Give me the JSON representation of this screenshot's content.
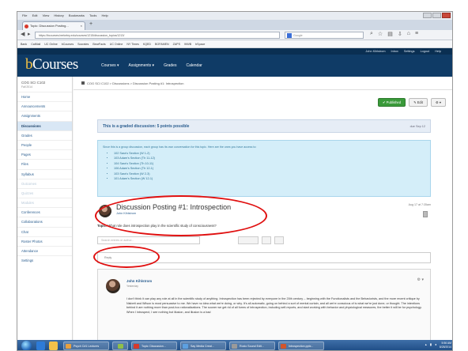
{
  "browser": {
    "menu": [
      "File",
      "Edit",
      "View",
      "History",
      "Bookmarks",
      "Tools",
      "Help"
    ],
    "tab_title": "Topic: Discussion Posting...",
    "tab_close": "×",
    "new_tab": "+",
    "url": "https://bcourses.berkeley.edu/courses/1215/discussion_topics/1213/",
    "search_placeholder": "Google",
    "bookmarks": [
      "Bank",
      "CalMail",
      "UC Online",
      "bCourses",
      "Socrates",
      "BearFacts",
      "UC Online",
      "NY Times",
      "KQED",
      "BOFAMEN",
      "ZAPS",
      "WWB",
      "bSpace"
    ]
  },
  "canvas": {
    "logo_b": "b",
    "logo_rest": "Courses",
    "nav": [
      "Courses ▾",
      "Assignments ▾",
      "Grades",
      "Calendar"
    ],
    "top_links": [
      "John Kihlstrom",
      "Inbox",
      "Settings",
      "Logout",
      "Help"
    ]
  },
  "course": {
    "code": "COG SCI C102",
    "term": "Fall 2014"
  },
  "leftnav": {
    "items": [
      "Home",
      "Announcements",
      "Assignments",
      "Discussions",
      "Grades",
      "People",
      "Pages",
      "Files",
      "Syllabus",
      "Outcomes",
      "Quizzes",
      "Modules",
      "Conferences",
      "Collaborations",
      "Chat",
      "Roster Photos",
      "Attendance",
      "Settings"
    ]
  },
  "main": {
    "breadcrumb": "COG SCI C102  >  Discussions  >  Discussion Posting #1: Introspection",
    "buttons": {
      "published": "✔ Published",
      "edit": "✎ Edit",
      "gear": "⚙ ▾"
    },
    "graded_title": "This is a graded discussion: 5 points possible",
    "graded_due": "due Sep 12",
    "group_intro": "Since this is a group discussion, each group has its own conversation for this topic. Here are the ones you have access to:",
    "groups": [
      "102 Sara's Section (W 1-2)",
      "103 Adam's Section (Th 11-12)",
      "104 Sara's Section (Th 10-11)",
      "106 Adam's Section (Th 12-1)",
      "103 Sara's Section (W 2-3)",
      "101 Adam's Section (W 12-1)"
    ],
    "topic": {
      "title": "Discussion Posting #1: Introspection",
      "author": "John Kihlstrom",
      "date": "Aug 17 at 7:35am",
      "prompt_label": "Topic:",
      "prompt": "What role does introspection play in the scientific study of consciousness?"
    },
    "search_placeholder": "Search entries or author...",
    "reply_placeholder": "Reply",
    "reply": {
      "author": "John Kihlstrom",
      "when": "Yesterday",
      "gear": "⚙ ▾",
      "body": "I don't think it can play any role at all in the scientific study of anything. Introspection has been rejected by everyone in the 20th century -- beginning with the Functionalists and the Behaviorists, and the more recent critique by Nisbett and Wilson is most persuasive to me. We have no idea what we're doing, or why. It's all automatic, going on behind a sort of mental curtain, and all we're conscious of is what we're just done, or thought. The intentions behind it are nothing more than post-hoc rationalizations. The sooner we get rid of all forms of introspection, including self-reports, and start working with behavior and physiological measures, the better it will be for psychology. When I introspect, I see nothing but illusion, and illusion is a bad"
    }
  },
  "taskbar": {
    "tasks": [
      "Psych C#1 Lectures",
      "",
      "Topic: Discussion...",
      "Say Media Creat...",
      "Roxio Sound Edit...",
      "Introspection.pptx..."
    ],
    "time": "5:56 AM",
    "date": "8/28/2014"
  },
  "colors": {
    "canvas_header": "#0f3b66",
    "link": "#2a5d8f",
    "annotation": "#e01010",
    "published": "#3a9a3a"
  }
}
